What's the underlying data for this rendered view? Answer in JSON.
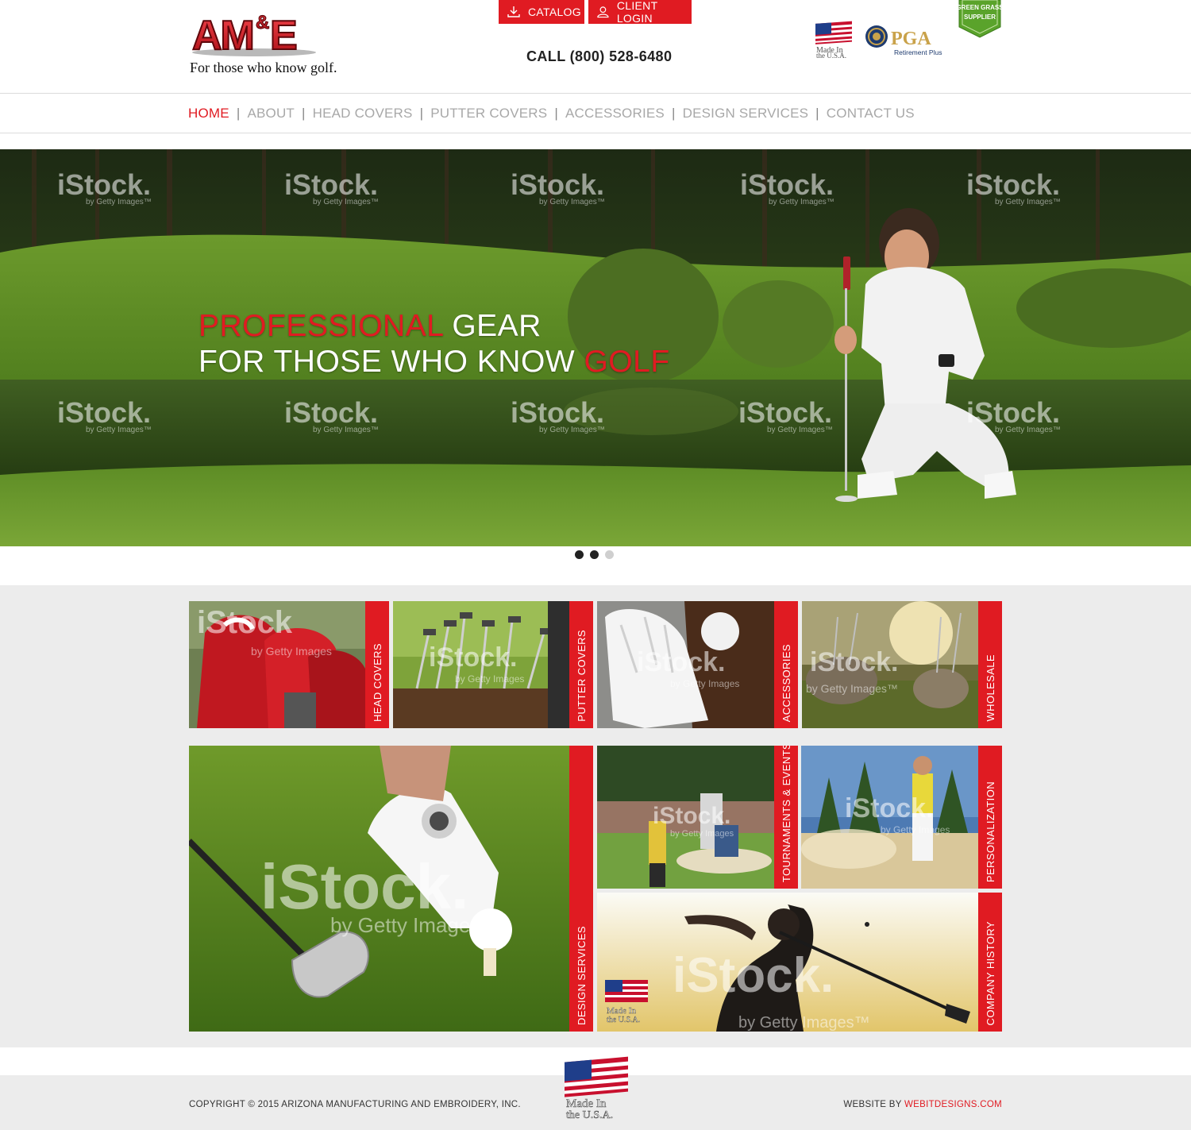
{
  "header": {
    "logo_text": "AM&E",
    "tagline": "For those who know golf.",
    "catalog_label": "CATALOG",
    "client_login_label": "CLIENT LOGIN",
    "phone": "CALL (800) 528-6480",
    "made_in_usa_small": "Made In the U.S.A.",
    "pga_label": "PGA",
    "pga_sub": "Retirement Plus",
    "badge_text": "GREEN GRASS SUPPLIER"
  },
  "nav": {
    "items": [
      {
        "label": "HOME",
        "active": true
      },
      {
        "label": "ABOUT",
        "active": false
      },
      {
        "label": "HEAD COVERS",
        "active": false
      },
      {
        "label": "PUTTER COVERS",
        "active": false
      },
      {
        "label": "ACCESSORIES",
        "active": false
      },
      {
        "label": "DESIGN SERVICES",
        "active": false
      },
      {
        "label": "CONTACT US",
        "active": false
      }
    ]
  },
  "hero": {
    "line1_red": "PROFESSIONAL",
    "line1_white": "GEAR",
    "line2_white": "FOR THOSE WHO KNOW",
    "line2_red": "GOLF",
    "watermark": "iStock.",
    "watermark_sub": "by Getty Images™",
    "slides": 3,
    "active_slide": 2
  },
  "tiles": [
    {
      "label": "HEAD COVERS"
    },
    {
      "label": "PUTTER COVERS"
    },
    {
      "label": "ACCESSORIES"
    },
    {
      "label": "WHOLESALE"
    },
    {
      "label": "DESIGN SERVICES"
    },
    {
      "label": "TOURNAMENTS & EVENTS"
    },
    {
      "label": "PERSONALIZATION"
    },
    {
      "label": "COMPANY HISTORY"
    }
  ],
  "footer": {
    "copyright": "COPYRIGHT © 2015 ARIZONA MANUFACTURING AND EMBROIDERY, INC.",
    "credit_prefix": "WEBSITE BY",
    "credit_link": "WEBITDESIGNS.COM",
    "made_in_usa": "Made In the U.S.A."
  },
  "colors": {
    "accent_red": "#e01b22",
    "nav_inactive": "#a8a8a8",
    "section_bg": "#ececec"
  }
}
